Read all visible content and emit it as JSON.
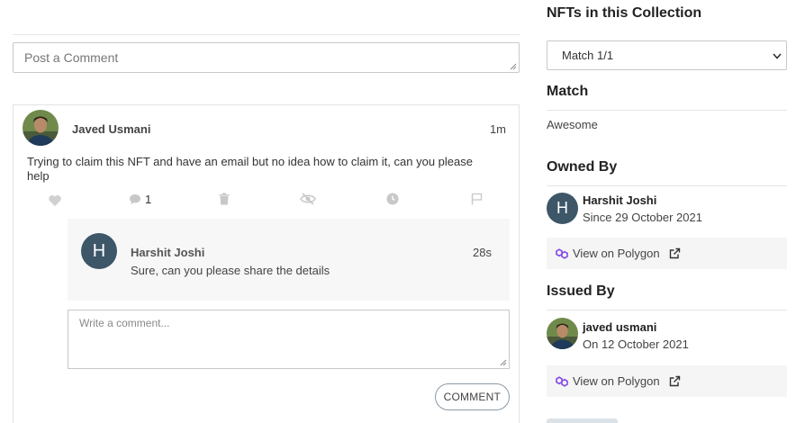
{
  "comments": {
    "post_placeholder": "Post a Comment",
    "main": {
      "author": "Javed Usmani",
      "time": "1m",
      "text": "Trying to claim this NFT and have an email but no idea how to claim it, can you please help",
      "reply_count": "1"
    },
    "reply": {
      "avatar_letter": "H",
      "author": "Harshit Joshi",
      "time": "28s",
      "text": "Sure, can you please share the details"
    },
    "write_placeholder": "Write a comment...",
    "submit_label": "COMMENT"
  },
  "sidebar": {
    "collection_title": "NFTs in this Collection",
    "collection_selected": "Match 1/1",
    "match_title": "Match",
    "match_text": "Awesome",
    "owned_title": "Owned By",
    "owner": {
      "avatar_letter": "H",
      "name": "Harshit Joshi",
      "since": "Since 29 October 2021"
    },
    "owned_polygon": "View on Polygon",
    "issued_title": "Issued By",
    "issuer": {
      "name": "javed usmani",
      "date": "On 12 October 2021"
    },
    "issued_polygon": "View on Polygon"
  },
  "colors": {
    "avatar_bg": "#3d5668",
    "polygon_purple": "#8247e5"
  }
}
